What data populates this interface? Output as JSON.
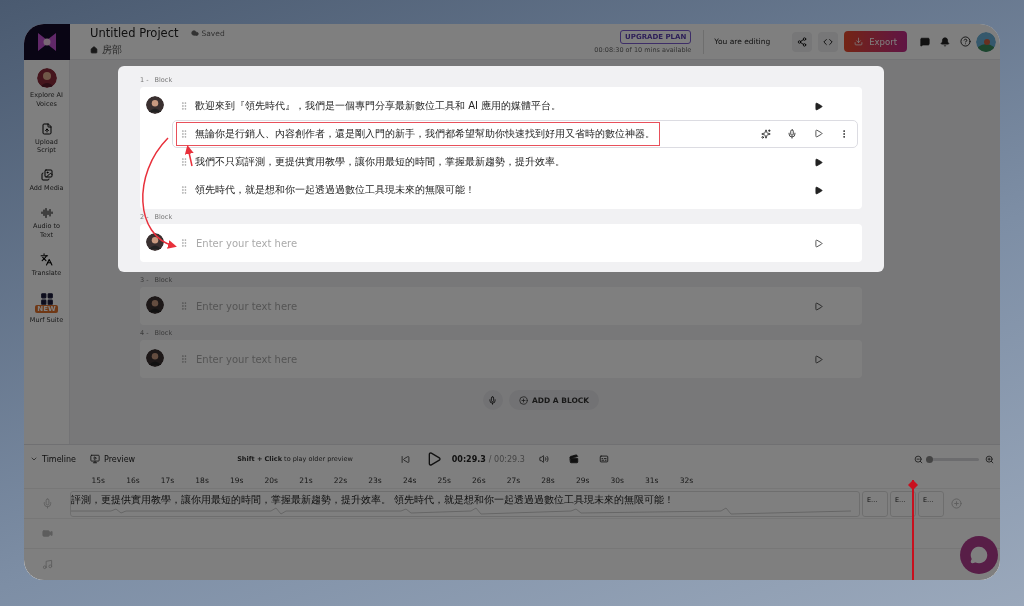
{
  "header": {
    "title": "Untitled Project",
    "save_status": "Saved",
    "breadcrumb": "房部",
    "upgrade_button": "UPGRADE PLAN",
    "usage": "00:08:30 of 10 mins available",
    "editing_status": "You are editing",
    "export_button": "Export"
  },
  "sidebar": {
    "items": [
      {
        "label": "Explore AI Voices",
        "kind": "avatar"
      },
      {
        "label": "Upload Script",
        "kind": "upload"
      },
      {
        "label": "Add Media",
        "kind": "media"
      },
      {
        "label": "Audio to Text",
        "kind": "transcribe"
      },
      {
        "label": "Translate",
        "kind": "translate"
      },
      {
        "label": "Murf Suite",
        "kind": "suite",
        "badge": "NEW"
      }
    ]
  },
  "blocks": [
    {
      "number": "1 -",
      "label": "Block",
      "spotlight": true,
      "rows": [
        {
          "text": "歡迎來到『領先時代』，我們是一個專門分享最新數位工具和 AI 應用的媒體平台。",
          "selected": false,
          "highlighted": false
        },
        {
          "text": "無論你是行銷人、內容創作者，還是剛入門的新手，我們都希望幫助你快速找到好用又省時的數位神器。",
          "selected": true,
          "highlighted": true
        },
        {
          "text": "我們不只寫評測，更提供實用教學，讓你用最短的時間，掌握最新趨勢，提升效率。",
          "selected": false,
          "highlighted": false
        },
        {
          "text": "領先時代，就是想和你一起透過過數位工具現未來的無限可能！",
          "selected": false,
          "highlighted": false
        }
      ]
    },
    {
      "number": "2 -",
      "label": "Block",
      "spotlight": true,
      "placeholder": "Enter your text here"
    },
    {
      "number": "3 -",
      "label": "Block",
      "spotlight": false,
      "placeholder": "Enter your text here"
    },
    {
      "number": "4 -",
      "label": "Block",
      "spotlight": false,
      "placeholder": "Enter your text here"
    }
  ],
  "add_block_button": "ADD A BLOCK",
  "timeline": {
    "title": "Timeline",
    "preview": "Preview",
    "hint": "**Shift + Click** to play older preview",
    "current_time": "00:29.3",
    "total_time": "/ 00:29.3",
    "ruler": [
      "15s",
      "16s",
      "17s",
      "18s",
      "19s",
      "20s",
      "21s",
      "22s",
      "23s",
      "24s",
      "25s",
      "26s",
      "27s",
      "28s",
      "29s",
      "30s",
      "31s",
      "32s"
    ],
    "audio_clip": "評測，更提供實用教學，讓你用最短的時間，掌握最新趨勢，提升效率。 領先時代，就是想和你一起透過過數位工具現未來的無限可能！",
    "short_clips": [
      "E…",
      "E…",
      "E…"
    ],
    "zoom_slider": {
      "level": 0.0
    }
  }
}
